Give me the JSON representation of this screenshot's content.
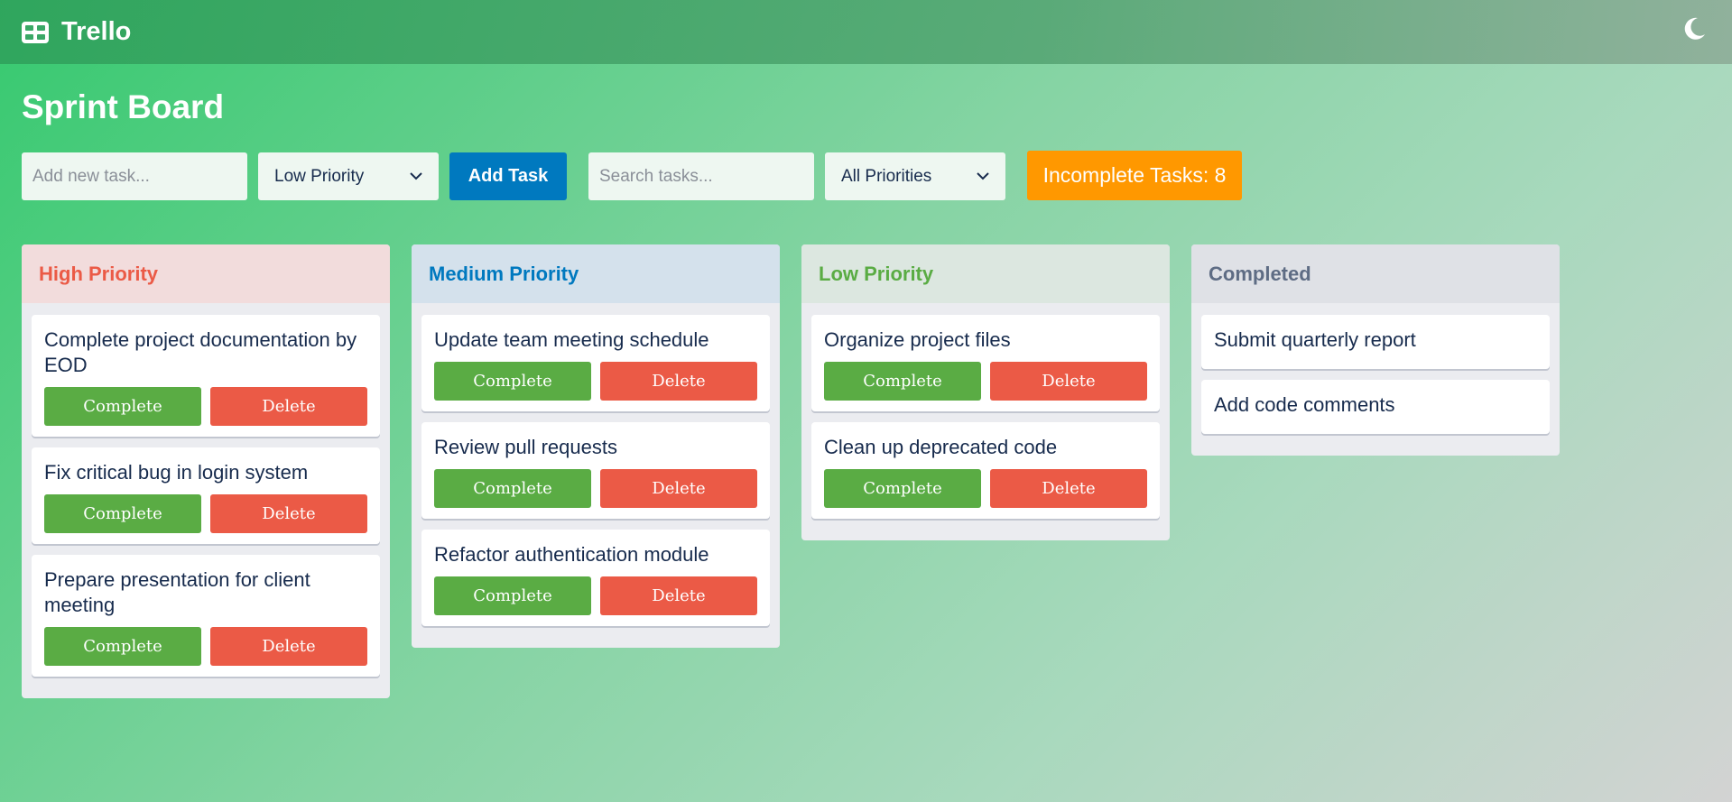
{
  "app": {
    "name": "Trello"
  },
  "board": {
    "title": "Sprint Board"
  },
  "controls": {
    "new_task_placeholder": "Add new task...",
    "priority_select": "Low Priority",
    "add_button": "Add Task",
    "search_placeholder": "Search tasks...",
    "filter_select": "All Priorities",
    "incomplete_badge": "Incomplete Tasks: 8"
  },
  "colors": {
    "high": "#eb5a46",
    "medium": "#0079bf",
    "low": "#5aac44",
    "completed": "#5e6c84",
    "badge": "#ff9800",
    "add_button": "#0079bf"
  },
  "columns": {
    "high": {
      "title": "High Priority",
      "cards": [
        {
          "title": "Complete project documentation by EOD",
          "complete": "Complete",
          "delete": "Delete"
        },
        {
          "title": "Fix critical bug in login system",
          "complete": "Complete",
          "delete": "Delete"
        },
        {
          "title": "Prepare presentation for client meeting",
          "complete": "Complete",
          "delete": "Delete"
        }
      ]
    },
    "medium": {
      "title": "Medium Priority",
      "cards": [
        {
          "title": "Update team meeting schedule",
          "complete": "Complete",
          "delete": "Delete"
        },
        {
          "title": "Review pull requests",
          "complete": "Complete",
          "delete": "Delete"
        },
        {
          "title": "Refactor authentication module",
          "complete": "Complete",
          "delete": "Delete"
        }
      ]
    },
    "low": {
      "title": "Low Priority",
      "cards": [
        {
          "title": "Organize project files",
          "complete": "Complete",
          "delete": "Delete"
        },
        {
          "title": "Clean up deprecated code",
          "complete": "Complete",
          "delete": "Delete"
        }
      ]
    },
    "completed": {
      "title": "Completed",
      "cards": [
        {
          "title": "Submit quarterly report"
        },
        {
          "title": "Add code comments"
        }
      ]
    }
  },
  "icons": {
    "logo": "board-icon",
    "theme": "moon-icon",
    "select": "chevron-down-icon"
  }
}
